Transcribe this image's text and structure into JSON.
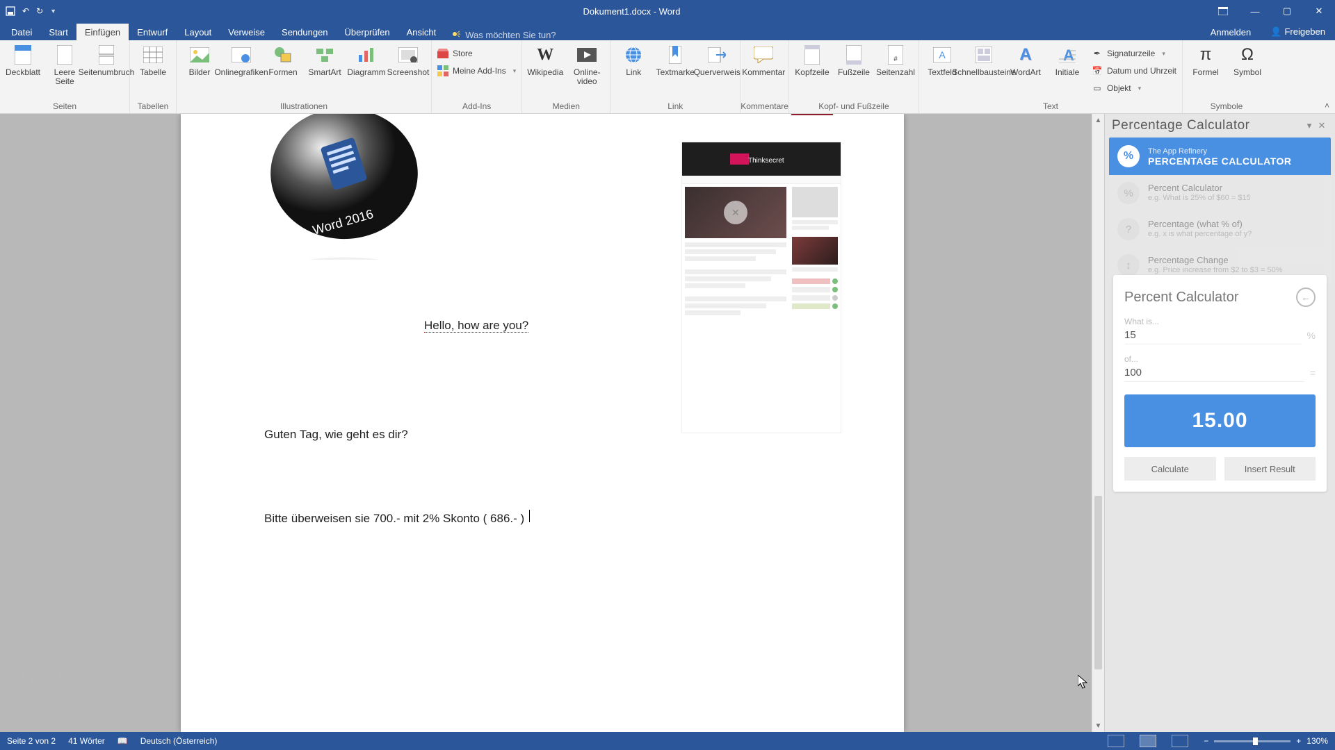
{
  "colors": {
    "brand": "#2b579a",
    "accent": "#4a90e2"
  },
  "titlebar": {
    "document_title": "Dokument1.docx - Word"
  },
  "tabs": {
    "items": [
      "Datei",
      "Start",
      "Einfügen",
      "Entwurf",
      "Layout",
      "Verweise",
      "Sendungen",
      "Überprüfen",
      "Ansicht"
    ],
    "active_index": 2,
    "tell_me_placeholder": "Was möchten Sie tun?",
    "account": "Anmelden",
    "share": "Freigeben"
  },
  "ribbon": {
    "groups": {
      "seiten": {
        "label": "Seiten",
        "deckblatt": "Deckblatt",
        "leere_seite": "Leere Seite",
        "seitenumbruch": "Seitenumbruch"
      },
      "tabellen": {
        "label": "Tabellen",
        "tabelle": "Tabelle"
      },
      "illustrationen": {
        "label": "Illustrationen",
        "bilder": "Bilder",
        "onlinegrafiken": "Onlinegrafiken",
        "formen": "Formen",
        "smartart": "SmartArt",
        "diagramm": "Diagramm",
        "screenshot": "Screenshot"
      },
      "addins": {
        "label": "Add-Ins",
        "store": "Store",
        "meine_addins": "Meine Add-Ins"
      },
      "medien": {
        "label": "Medien",
        "wikipedia": "Wikipedia",
        "onlinevideo": "Online-video"
      },
      "link": {
        "label": "Link",
        "link": "Link",
        "textmarke": "Textmarke",
        "querverweis": "Querverweis"
      },
      "kommentare": {
        "label": "Kommentare",
        "kommentar": "Kommentar"
      },
      "kopf": {
        "label": "Kopf- und Fußzeile",
        "kopfzeile": "Kopfzeile",
        "fusszeile": "Fußzeile",
        "seitenzahl": "Seitenzahl"
      },
      "text": {
        "label": "Text",
        "textfeld": "Textfeld",
        "schnellbausteine": "Schnellbausteine",
        "wordart": "WordArt",
        "initiale": "Initiale",
        "signaturzeile": "Signaturzeile",
        "datum": "Datum und Uhrzeit",
        "objekt": "Objekt"
      },
      "symbole": {
        "label": "Symbole",
        "formel": "Formel",
        "symbol": "Symbol"
      }
    }
  },
  "document": {
    "hello": "Hello, how are you?",
    "guten": "Guten Tag, wie geht es dir?",
    "bitte": "Bitte überweisen sie 700.- mit 2% Skonto ( 686.- ) ",
    "thumb_brand": "Thinksecret"
  },
  "pane": {
    "title": "Percentage Calculator",
    "addin_vendor": "The App Refinery",
    "addin_name": "PERCENTAGE CALCULATOR",
    "options": [
      {
        "title": "Percent Calculator",
        "example": "e.g. What is 25% of $60 = $15"
      },
      {
        "title": "Percentage (what % of)",
        "example": "e.g. x is what percentage of y?"
      },
      {
        "title": "Percentage Change",
        "example": "e.g. Price increase from $2 to $3 = 50%"
      }
    ],
    "calc": {
      "card_title": "Percent Calculator",
      "whatis_label": "What is...",
      "whatis_value": "15",
      "pct_suffix": "%",
      "of_label": "of...",
      "of_value": "100",
      "eq_suffix": "=",
      "result": "15.00",
      "calculate": "Calculate",
      "insert": "Insert Result"
    }
  },
  "status": {
    "page": "Seite 2 von 2",
    "words": "41 Wörter",
    "lang": "Deutsch (Österreich)",
    "zoom": "130%"
  }
}
